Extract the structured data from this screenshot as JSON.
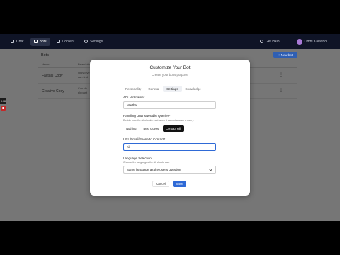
{
  "nav": {
    "items": [
      {
        "label": "Chat",
        "icon": "chat-icon"
      },
      {
        "label": "Bots",
        "icon": "bot-icon"
      },
      {
        "label": "Content",
        "icon": "content-icon"
      },
      {
        "label": "Settings",
        "icon": "gear-icon"
      }
    ],
    "active": "Bots",
    "help_label": "Get Help",
    "user_name": "Omni Kalasho"
  },
  "page": {
    "title": "Bots",
    "new_button": "+ New bot",
    "columns": [
      "Name",
      "Description"
    ],
    "rows": [
      {
        "name": "Factual Cody",
        "desc_line1": "Only give",
        "desc_line2": "can find"
      },
      {
        "name": "Creative Cody",
        "desc_line1": "Can do",
        "desc_line2": "elegant"
      }
    ]
  },
  "overlay": {
    "chip_label": "0:08"
  },
  "modal": {
    "title": "Customize Your Bot",
    "subtitle": "Create your bot's purpose",
    "tabs": [
      "Personality",
      "General",
      "Settings",
      "Knowledge"
    ],
    "active_tab": "Settings",
    "nickname": {
      "label": "AI's Nickname*",
      "value": "Martha"
    },
    "unanswerable": {
      "label": "Handling Unanswerable Queries*",
      "hint": "Decide how the AI should react when it cannot answer a query.",
      "options": [
        "Nothing",
        "Best Guess",
        "Contact Hill"
      ],
      "selected": "Contact Hill"
    },
    "contact": {
      "label": "URL/Email/Phone to Contact*",
      "value": "hil"
    },
    "language": {
      "label": "Language Selection",
      "hint": "Choose the languages the AI should use.",
      "selected": "Same language as the user's question"
    },
    "cancel_label": "Cancel",
    "save_label": "Save"
  },
  "colors": {
    "nav_bg": "#0f1426",
    "primary": "#2f6ad6",
    "segment_active": "#121212",
    "record": "#c62828"
  }
}
